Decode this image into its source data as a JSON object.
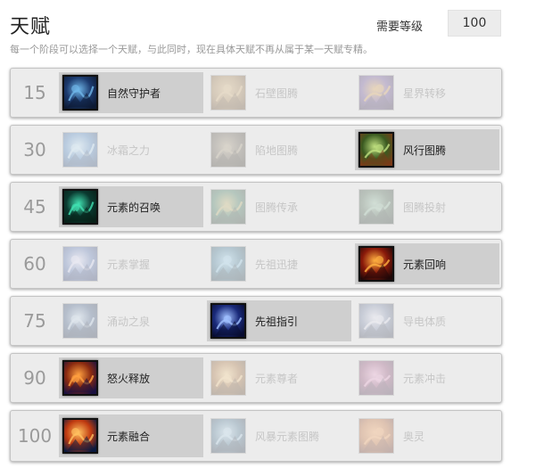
{
  "header": {
    "title": "天赋",
    "level_label": "需要等级",
    "level_value": "100",
    "subtitle": "每一个阶段可以选择一个天赋，与此同时，现在具体天赋不再从属于某一天赋专精。"
  },
  "colors": {
    "row_bg": "#ececec",
    "selected_bg": "#cfcfcf",
    "tier_text": "#9a9a9a",
    "dim_text": "#c6c6c6"
  },
  "tiers": [
    {
      "level": "15",
      "talents": [
        {
          "name": "自然守护者",
          "icon": "nature-guardian-icon",
          "selected": true,
          "palette": [
            "#1c3a6e",
            "#6fb6e8",
            "#0d1a33"
          ]
        },
        {
          "name": "石壁图腾",
          "icon": "stone-bulwark-totem-icon",
          "selected": false,
          "palette": [
            "#a07840",
            "#d8b070",
            "#5a3a18"
          ]
        },
        {
          "name": "星界转移",
          "icon": "astral-shift-icon",
          "selected": false,
          "palette": [
            "#5a3a8a",
            "#e0a040",
            "#2a1840"
          ]
        }
      ]
    },
    {
      "level": "30",
      "talents": [
        {
          "name": "冰霜之力",
          "icon": "frozen-power-icon",
          "selected": false,
          "palette": [
            "#3a7ac0",
            "#bfe6ff",
            "#1a3a6a"
          ]
        },
        {
          "name": "陷地图腾",
          "icon": "earthgrab-totem-icon",
          "selected": false,
          "palette": [
            "#5a5040",
            "#a89878",
            "#2a2418"
          ]
        },
        {
          "name": "风行图腾",
          "icon": "windwalk-totem-icon",
          "selected": true,
          "palette": [
            "#3a5a20",
            "#c0e080",
            "#7a3a18"
          ]
        }
      ]
    },
    {
      "level": "45",
      "talents": [
        {
          "name": "元素的召唤",
          "icon": "call-of-the-elements-icon",
          "selected": true,
          "palette": [
            "#0a3a30",
            "#40e0b0",
            "#082018"
          ]
        },
        {
          "name": "图腾传承",
          "icon": "totemic-persistence-icon",
          "selected": false,
          "palette": [
            "#2a6a4a",
            "#c0b060",
            "#1a3020"
          ]
        },
        {
          "name": "图腾投射",
          "icon": "totemic-projection-icon",
          "selected": false,
          "palette": [
            "#3a5a40",
            "#90c0a0",
            "#1a2a20"
          ]
        }
      ]
    },
    {
      "level": "60",
      "talents": [
        {
          "name": "元素掌握",
          "icon": "elemental-mastery-icon",
          "selected": false,
          "palette": [
            "#4a6ab0",
            "#e0e0ff",
            "#1a2a60"
          ]
        },
        {
          "name": "先祖迅捷",
          "icon": "ancestral-swiftness-icon",
          "selected": false,
          "palette": [
            "#2a6a8a",
            "#90d0f0",
            "#103040"
          ]
        },
        {
          "name": "元素回响",
          "icon": "echo-of-the-elements-icon",
          "selected": true,
          "palette": [
            "#8a1a0a",
            "#ffb040",
            "#200808"
          ]
        }
      ]
    },
    {
      "level": "75",
      "talents": [
        {
          "name": "涌动之泉",
          "icon": "healing-tide-totem-icon",
          "selected": false,
          "palette": [
            "#2a4a7a",
            "#c0d8f0",
            "#102040"
          ]
        },
        {
          "name": "先祖指引",
          "icon": "ancestral-guidance-icon",
          "selected": true,
          "palette": [
            "#1a2a7a",
            "#a0c0ff",
            "#080c30"
          ]
        },
        {
          "name": "导电体质",
          "icon": "conductivity-icon",
          "selected": false,
          "palette": [
            "#6a7aa0",
            "#e8e8f8",
            "#303850"
          ]
        }
      ]
    },
    {
      "level": "90",
      "talents": [
        {
          "name": "怒火释放",
          "icon": "unleashed-fury-icon",
          "selected": true,
          "palette": [
            "#8a2a10",
            "#ffa040",
            "#1a1040"
          ]
        },
        {
          "name": "元素尊者",
          "icon": "primal-elementalist-icon",
          "selected": false,
          "palette": [
            "#a06020",
            "#ffd080",
            "#503010"
          ]
        },
        {
          "name": "元素冲击",
          "icon": "elemental-blast-icon",
          "selected": false,
          "palette": [
            "#8a3a6a",
            "#f0a0d0",
            "#402040"
          ]
        }
      ]
    },
    {
      "level": "100",
      "talents": [
        {
          "name": "元素融合",
          "icon": "elemental-fusion-icon",
          "selected": true,
          "palette": [
            "#c03a10",
            "#ffc060",
            "#0a1a40"
          ]
        },
        {
          "name": "风暴元素图腾",
          "icon": "storm-elemental-totem-icon",
          "selected": false,
          "palette": [
            "#3a6a8a",
            "#b0d8f0",
            "#182a40"
          ]
        },
        {
          "name": "奥灵",
          "icon": "liquid-magma-icon",
          "selected": false,
          "palette": [
            "#c06020",
            "#ffa050",
            "#602010"
          ]
        }
      ]
    }
  ]
}
